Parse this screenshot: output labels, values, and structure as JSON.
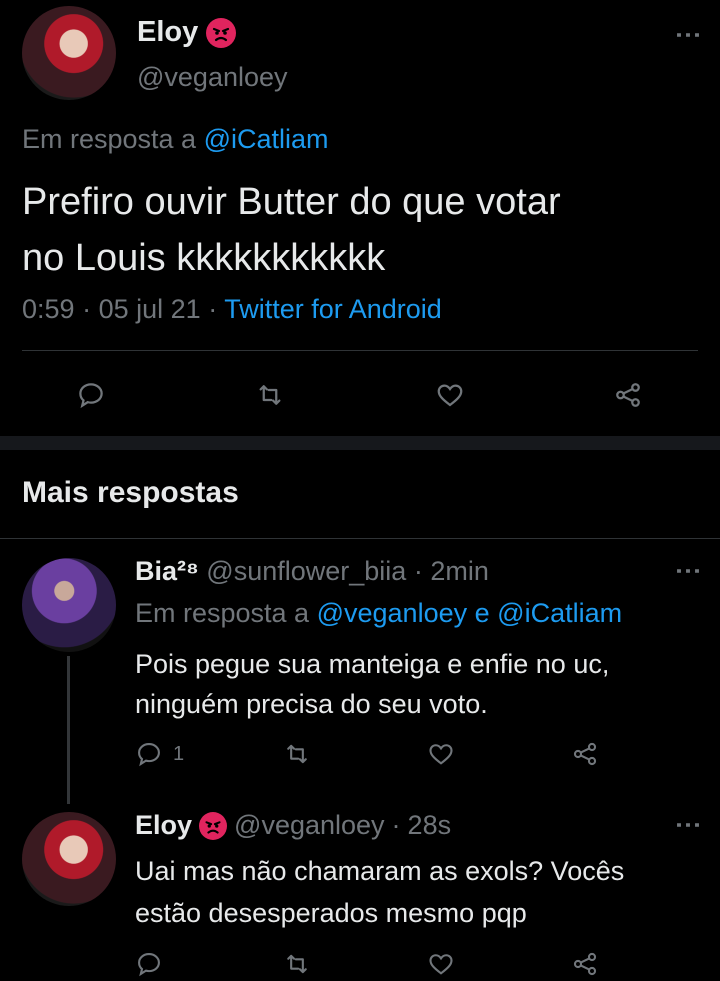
{
  "main_tweet": {
    "name": "Eloy",
    "handle": "@veganloey",
    "reply_prefix": "Em resposta a",
    "reply_to": "@iCatliam",
    "text_line1": "Prefiro ouvir Butter do que votar",
    "text_line2": "no Louis kkkkkkkkkkk",
    "time": "0:59",
    "date": "05 jul 21",
    "source": "Twitter for Android"
  },
  "section_title": "Mais respostas",
  "reply1": {
    "name": "Bia²⁸",
    "handle": "@sunflower_biia",
    "time": "2min",
    "reply_prefix": "Em resposta a",
    "reply_to1": "@veganloey",
    "conj": "e",
    "reply_to2": "@iCatliam",
    "text_line1": "Pois pegue sua manteiga e enfie no uc,",
    "text_line2": "ninguém precisa do seu voto.",
    "reply_count": "1"
  },
  "reply2": {
    "name": "Eloy",
    "handle": "@veganloey",
    "time": "28s",
    "text_line1": "Uai mas não chamaram as exols? Vocês",
    "text_line2": "estão desesperados mesmo pqp"
  },
  "separator": "·",
  "icons": [
    "angry-face-icon",
    "more-options-icon",
    "reply-icon",
    "retweet-icon",
    "like-icon",
    "share-icon"
  ],
  "colors": {
    "background": "#000000",
    "link": "#1d9bf0",
    "muted": "#71767b",
    "text": "#e7e9ea",
    "emoji": "#e0245e"
  }
}
